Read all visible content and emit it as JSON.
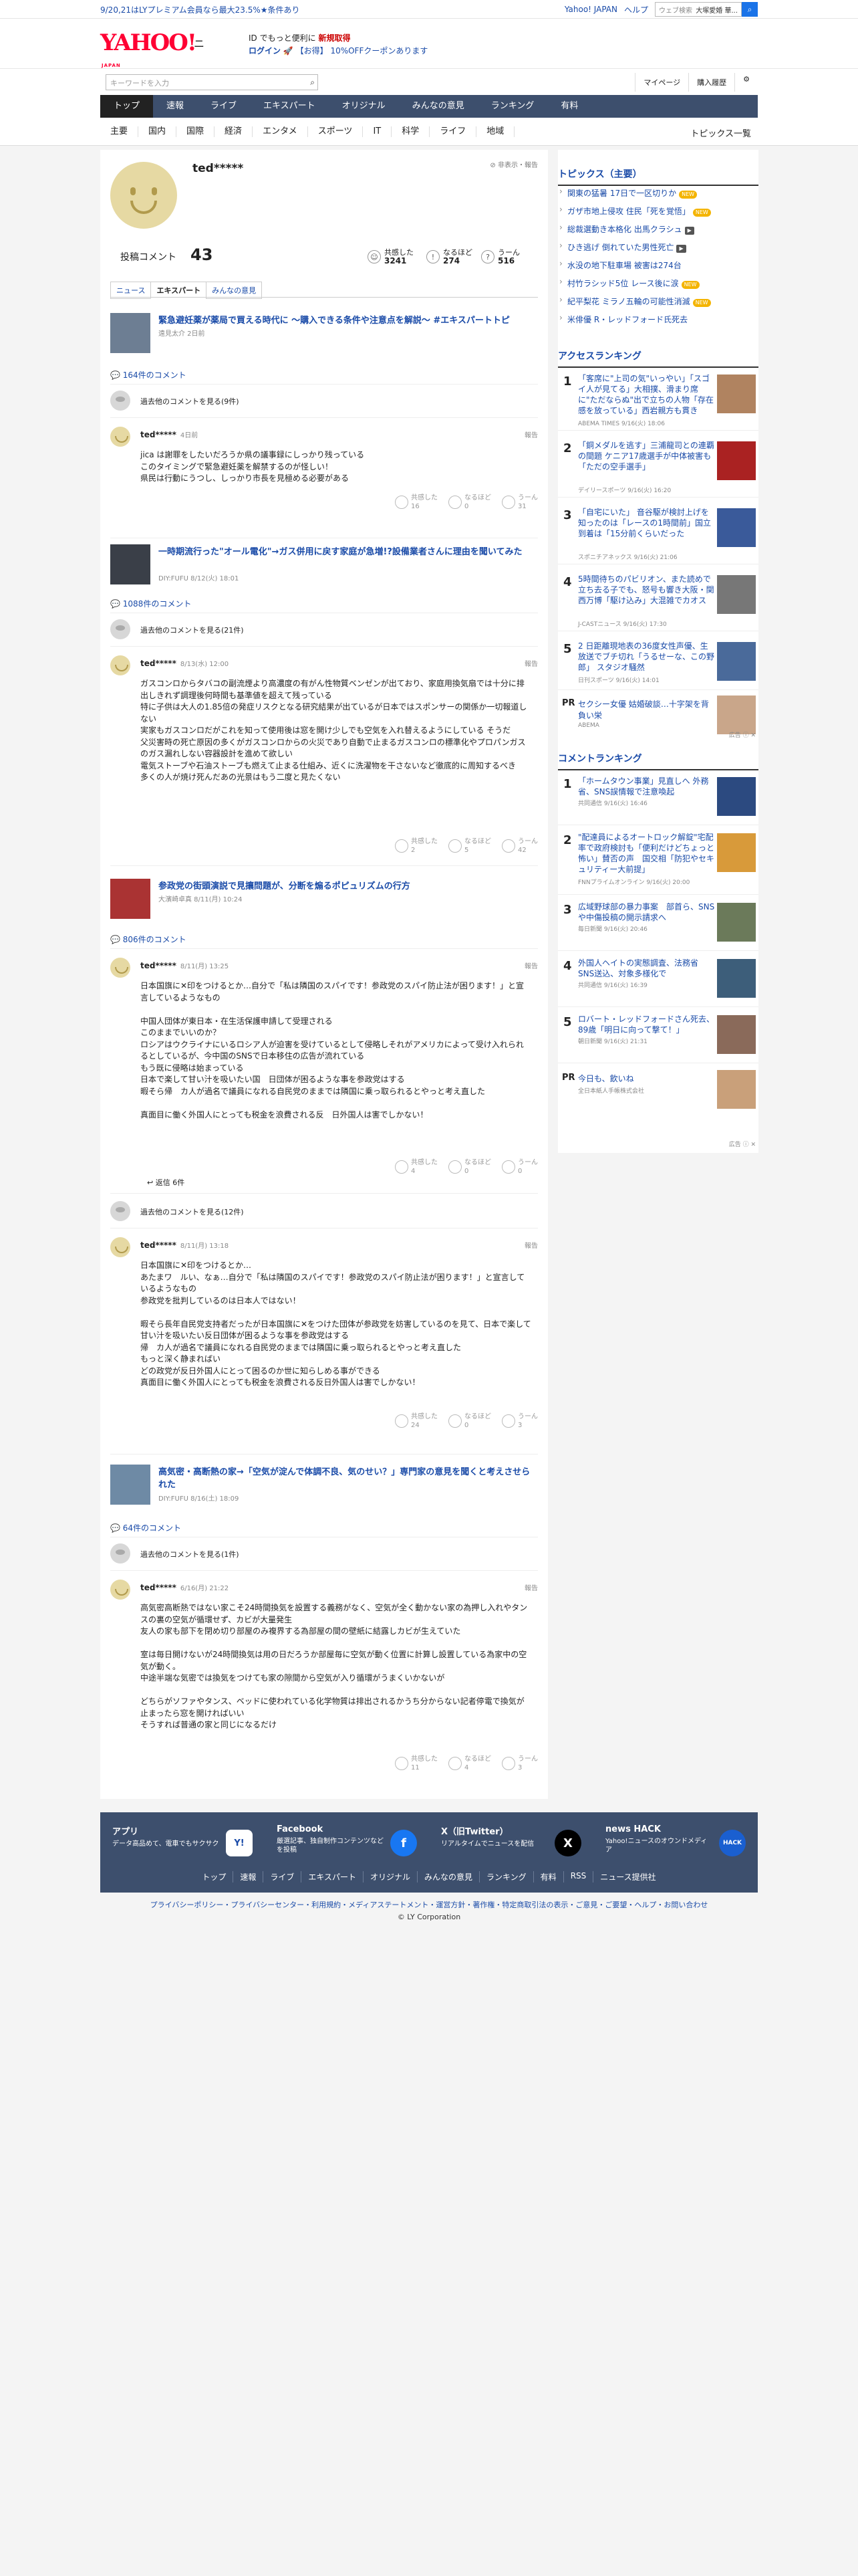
{
  "promo": {
    "text": "9/20,21はLYプレミアム会員なら最大23.5%★条件あり",
    "yahoo_japan": "Yahoo! JAPAN",
    "help": "ヘルプ",
    "search_placeholder": "ウェブ検索",
    "search_value": "大塚愛婚 華..."
  },
  "header": {
    "logo": "YAHOO!",
    "logo_sub": "JAPAN",
    "section": "ニュース",
    "msg1a": "ID でもっと便利に",
    "msg1b": "新規取得",
    "msg2a": "ログイン",
    "msg2b": "【お得】 10%OFFクーポンあります"
  },
  "search": {
    "placeholder": "キーワードを入力",
    "mypage": "マイページ",
    "history": "購入履歴"
  },
  "nav": [
    "トップ",
    "速報",
    "ライブ",
    "エキスパート",
    "オリジナル",
    "みんなの意見",
    "ランキング",
    "有料"
  ],
  "subnav": [
    "主要",
    "国内",
    "国際",
    "経済",
    "エンタメ",
    "スポーツ",
    "IT",
    "科学",
    "ライフ",
    "地域"
  ],
  "subnav_right": "トピックス一覧",
  "profile": {
    "name": "ted*****",
    "report": "非表示・報告",
    "comments_label": "投稿コメント",
    "comments_count": "43",
    "r1_label": "共感した",
    "r1_val": "3241",
    "r2_label": "なるほど",
    "r2_val": "274",
    "r3_label": "うーん",
    "r3_val": "516"
  },
  "tabs": [
    "ニュース",
    "エキスパート",
    "みんなの意見"
  ],
  "articles": [
    {
      "title": "緊急避妊薬が薬局で買える時代に 〜購入できる条件や注意点を解説〜 #エキスパートトピ",
      "meta": "遠見太介 2日前",
      "count": "164件のコメント",
      "prev": "過去他のコメントを見る(9件)",
      "comments": [
        {
          "name": "ted*****",
          "date": "4日前",
          "report": "報告",
          "body": "jica は謝罪をしたいだろうか県の議事録にしっかり残っている\nこのタイミングで緊急避妊薬を解禁するのが怪しい！\n県民は行動にうつし、しっかり市長を見極める必要がある",
          "r1": "16",
          "r2": "0",
          "r3": "31"
        }
      ]
    },
    {
      "title": "一時期流行った\"オール電化\"→ガス併用に戻す家庭が急増!?設備業者さんに理由を聞いてみた",
      "meta": "DIY:FUFU 8/12(火) 18:01",
      "count": "1088件のコメント",
      "prev": "過去他のコメントを見る(21件)",
      "comments": [
        {
          "name": "ted*****",
          "date": "8/13(水) 12:00",
          "report": "報告",
          "body": "ガスコンロからタバコの副流煙より高濃度の有がん性物質ベンゼンが出ており、家庭用換気扇では十分に排出しきれず調理後何時間も基準値を超えて残っている\n特に子供は大人の1.85倍の発症リスクとなる研究結果が出ているが日本ではスポンサーの関係か一切報道しない\n実家もガスコンロだがこれを知って使用後は窓を開け少しでも空気を入れ替えるようにしている そうだ\n父災害時の死亡原因の多くがガスコンロからの火災であり自動で止まるガスコンロの標準化やプロパンガスのガス漏れしない容器設計を進めて欲しい\n電気ストーブや石油ストーブも燃えて止まる仕組み、近くに洗濯物を干さないなど徹底的に周知するべき\n多くの人が焼け死んだあの光景はもう二度と見たくない",
          "r1": "2",
          "r2": "5",
          "r3": "42"
        }
      ]
    },
    {
      "title": "参政党の街頭演説で見攘問題が、分断を煽るポピュリズムの行方",
      "meta": "大濱崎卓真 8/11(月) 10:24",
      "count": "806件のコメント",
      "comments": [
        {
          "name": "ted*****",
          "date": "8/11(月) 13:25",
          "report": "報告",
          "body": "日本国旗に✕印をつけるとか…自分で「私は隣国のスパイです！参政党のスパイ防止法が困ります！」と宣言しているようなもの\n\n中国人団体が東日本・在生活保護申請して受理される\nこのままでいいのか？\nロシアはウクライナにいるロシア人が迫害を受けているとして侵略しそれがアメリカによって受け入れられるとしているが、今中国のSNSで日本移住の広告が流れている\nもう既に侵略は始まっている\n日本で楽して甘い汁を吸いたい国　日団体が困るような事を参政党はする\n暇そら帰　カ人が過名で議員になれる自民党のままでは隣国に乗っ取られるとやっと考え直した\n\n真面目に働く外国人にとっても税金を浪費される反　日外国人は害でしかない！",
          "r1": "4",
          "r2": "0",
          "r3": "0"
        }
      ],
      "reply": "返信 6件",
      "prev": "過去他のコメントを見る(12件)",
      "comments2": [
        {
          "name": "ted*****",
          "date": "8/11(月) 13:18",
          "report": "報告",
          "body": "日本国旗に✕印をつけるとか…\nあたまワ　ルい、なぁ…自分で「私は隣国のスパイです！参政党のスパイ防止法が困ります！」と宣言しているようなもの\n参政党を批判しているのは日本人ではない！\n\n暇そら長年自民党支持者だったが日本国旗に✕をつけた団体が参政党を妨害しているのを見て、日本で楽して甘い汁を吸いたい反日団体が困るような事を参政党はする\n帰　カ人が過名で議員になれる自民党のままでは隣国に乗っ取られるとやっと考え直した\nもっと深く静まればい\nどの政党が反日外国人にとって困るのか世に知らしめる事ができる\n真面目に働く外国人にとっても税金を浪費される反日外国人は害でしかない！",
          "r1": "24",
          "r2": "0",
          "r3": "3"
        }
      ]
    },
    {
      "title": "高気密・高断熱の家→「空気が淀んで体調不良、気のせい？」専門家の意見を聞くと考えさせられた",
      "meta": "DIY:FUFU 8/16(土) 18:09",
      "count": "64件のコメント",
      "prev": "過去他のコメントを見る(1件)",
      "comments": [
        {
          "name": "ted*****",
          "date": "6/16(月) 21:22",
          "report": "報告",
          "body": "高気密高断熱ではない家こそ24時間換気を設置する義務がなく、空気が全く動かない家の為押し入れやタンスの裏の空気が循環せず、カビが大量発生\n友人の家も部下を閉め切り部屋のみ複界する為部屋の間の壁紙に結露しカビが生えていた\n\n室は毎日開けないが24時間換気は用の日だろうか部屋毎に空気が動く位置に計算し設置している為家中の空気が動く。\n中途半端な気密では換気をつけても家の隙間から空気が入り循環がうまくいかないが\n\nどちらがソファやタンス、ベッドに使われている化学物質は排出されるかうち分からない記者停電で換気が止まったら窓を開ければいい\nそうすれば普通の家と同じになるだけ",
          "r1": "11",
          "r2": "4",
          "r3": "3"
        }
      ]
    }
  ],
  "reactions_labels": {
    "r1": "共感した",
    "r2": "なるほど",
    "r3": "うーん"
  },
  "sidebar": {
    "topics_head": "トピックス（主要）",
    "topics": [
      {
        "t": "関東の猛暑 17日で一区切りか",
        "b": "NEW"
      },
      {
        "t": "ガザ市地上侵攻 住民「死を覚悟」",
        "b": "NEW"
      },
      {
        "t": "総裁選動き本格化 出馬クラシュ",
        "b": "cam"
      },
      {
        "t": "ひき逃げ 倒れていた男性死亡",
        "b": "cam"
      },
      {
        "t": "水没の地下駐車場 被害は274台",
        "b": ""
      },
      {
        "t": "村竹ラシッド5位 レース後に涙",
        "b": "NEW"
      },
      {
        "t": "紀平梨花 ミラノ五輪の可能性消滅",
        "b": "NEW"
      },
      {
        "t": "米俳優 R・レッドフォード氏死去",
        "b": ""
      }
    ],
    "access_head": "アクセスランキング",
    "access": [
      {
        "n": "1",
        "t": "「客席に\"上司の気\"いっやい」「スゴイ人が見てる」大相撲、滑まり席に\"ただならぬ\"出で立ちの人物「存在感を放っている」西岩親方も貫き",
        "s": "ABEMA TIMES 9/16(火) 18:06"
      },
      {
        "n": "2",
        "t": "「銅メダルを逃す」三浦龍司との連覇の間題 ケニア17歳選手が中体被害も「ただの空手選手」",
        "s": "デイリースポーツ 9/16(火) 16:20"
      },
      {
        "n": "3",
        "t": "「自宅にいた」 音谷駆が検討上げを知ったのは「レースの1時間前」国立到着は「15分前くらいだった",
        "s": "スポニチアネックス 9/16(火) 21:06"
      },
      {
        "n": "4",
        "t": "5時間待ちのパビリオン、また読めで立ち去る子でも、怒号も響き大阪・関西万博「駆け込み」大混雑でカオス",
        "s": "J-CASTニュース 9/16(火) 17:30"
      },
      {
        "n": "5",
        "t": "2 日距離現地表の36度女性声優、生放送でブチ切れ「うるせーな、この野郎」 スタジオ騒然",
        "s": "日刊スポーツ 9/16(火) 14:01"
      }
    ],
    "pr1": {
      "t": "セクシー女優 姑婚破談…十字架を背負い栄",
      "s": "ABEMA"
    },
    "ad_label": "広告",
    "comment_head": "コメントランキング",
    "comment": [
      {
        "n": "1",
        "t": "「ホームタウン事業」見直しへ 外務省、SNS誤情報で注意喚起",
        "s": "共同通信 9/16(火) 16:46"
      },
      {
        "n": "2",
        "t": "\"配達員によるオートロック解錠\"宅配率で政府検討も「便利だけどちょっと怖い」賛否の声　国交相「防犯やセキュリティー大前提」",
        "s": "FNNプライムオンライン 9/16(火) 20:00"
      },
      {
        "n": "3",
        "t": "広域野球部の暴力事案　部首ら、SNSや中傷投稿の開示請求へ",
        "s": "毎日新聞 9/16(火) 20:46"
      },
      {
        "n": "4",
        "t": "外国人ヘイトの実態調査、法務省 SNS送込、対象多様化で",
        "s": "共同通信 9/16(火) 16:39"
      },
      {
        "n": "5",
        "t": "ロバート・レッドフォードさん死去、89歳「明日に向って撃て！」",
        "s": "朝日新聞 9/16(火) 21:31"
      }
    ],
    "pr2": {
      "t": "今日も、飲いね",
      "s": "全日本紙人手帳株式会社"
    }
  },
  "footer": {
    "cells": [
      {
        "h": "アプリ",
        "d": "データ高品めて、電車でもサクサク",
        "i": "Y!"
      },
      {
        "h": "Facebook",
        "d": "厳選記事、独自制作コンテンツなどを投稿",
        "i": "f"
      },
      {
        "h": "X（旧Twitter）",
        "d": "リアルタイムでニュースを配信",
        "i": "X"
      },
      {
        "h": "news HACK",
        "d": "Yahoo!ニュースのオウンドメディア",
        "i": "HACK"
      }
    ],
    "links": [
      "トップ",
      "速報",
      "ライブ",
      "エキスパート",
      "オリジナル",
      "みんなの意見",
      "ランキング",
      "有料",
      "RSS",
      "ニュース提供社"
    ],
    "legal": "プライバシーポリシー・プライバシーセンター・利用規約・メディアステートメント・運営方針・著作権・特定商取引法の表示・ご意見・ご要望・ヘルプ・お問い合わせ",
    "copy": "© LY Corporation"
  }
}
